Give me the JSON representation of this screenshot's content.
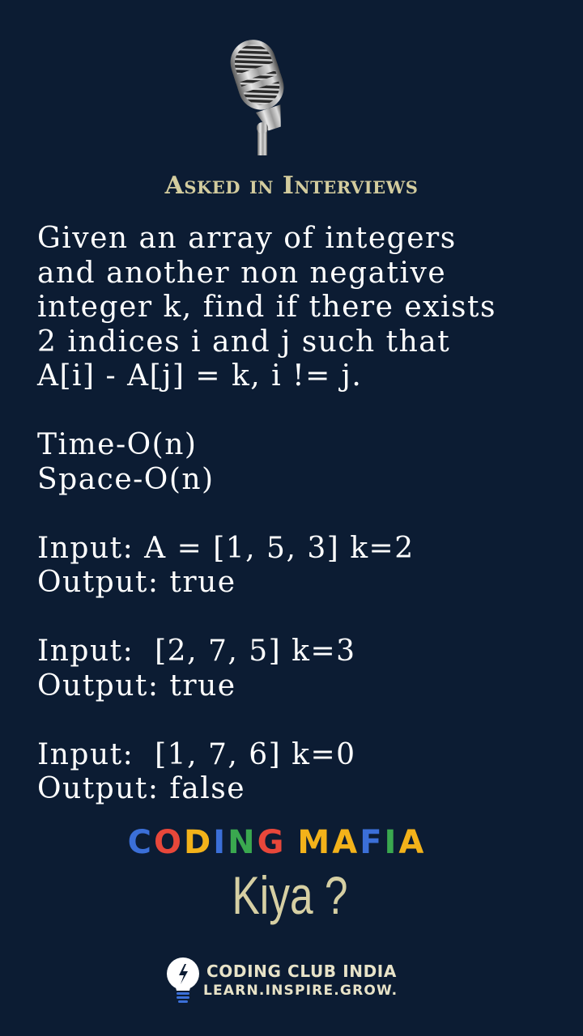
{
  "header": {
    "title": "Asked in Interviews"
  },
  "problem": {
    "lines": [
      "Given an array of integers",
      "and another non negative",
      "integer k, find if there exists",
      "2 indices i and j such that",
      "A[i] - A[j] = k, i != j.",
      "",
      "Time-O(n)",
      "Space-O(n)",
      "",
      "Input: A = [1, 5, 3] k=2",
      "Output: true",
      "",
      "Input:  [2, 7, 5] k=3",
      "Output: true",
      "",
      "Input:  [1, 7, 6] k=0",
      "Output: false"
    ]
  },
  "brand": {
    "letters": [
      {
        "char": "C",
        "color": "#3b6fd8"
      },
      {
        "char": "O",
        "color": "#e8473a"
      },
      {
        "char": "D",
        "color": "#f3b21a"
      },
      {
        "char": "I",
        "color": "#3b6fd8"
      },
      {
        "char": "N",
        "color": "#3aa84f"
      },
      {
        "char": "G",
        "color": "#e8473a"
      },
      {
        "char": " ",
        "color": "#ffffff"
      },
      {
        "char": "M",
        "color": "#f3b21a"
      },
      {
        "char": "A",
        "color": "#f3b21a"
      },
      {
        "char": "F",
        "color": "#3b6fd8"
      },
      {
        "char": "I",
        "color": "#3aa84f"
      },
      {
        "char": "A",
        "color": "#f3b21a"
      }
    ],
    "tagline": "Kiya ?"
  },
  "footer": {
    "org": "CODING CLUB INDIA",
    "motto": "LEARN.INSPIRE.GROW."
  }
}
